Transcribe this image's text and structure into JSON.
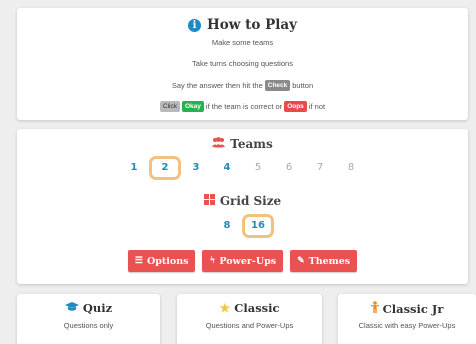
{
  "how_to_play": {
    "title": "How to Play",
    "step1": "Make some teams",
    "step2": "Take turns choosing questions",
    "step3_before": "Say the answer then hit the",
    "step3_pill": "Check",
    "step3_after": "button",
    "step4_click": "Click",
    "step4_okay": "Okay",
    "step4_mid": "if the team is correct or",
    "step4_oops": "Oops",
    "step4_after": "if not"
  },
  "teams": {
    "title": "Teams",
    "options": [
      "1",
      "2",
      "3",
      "4",
      "5",
      "6",
      "7",
      "8"
    ],
    "selected": "2"
  },
  "grid_size": {
    "title": "Grid Size",
    "options": [
      "8",
      "16"
    ],
    "selected": "16"
  },
  "buttons": {
    "options": "Options",
    "power_ups": "Power-Ups",
    "themes": "Themes"
  },
  "modes": [
    {
      "title": "Quiz",
      "desc": "Questions only",
      "icon": "graduation-cap-icon",
      "icon_color": "#1e8bbf"
    },
    {
      "title": "Classic",
      "desc": "Questions and Power-Ups",
      "icon": "star-icon",
      "icon_color": "#f4c542"
    },
    {
      "title": "Classic Jr",
      "desc": "Classic with easy Power-Ups",
      "icon": "child-icon",
      "icon_color": "#f08a24"
    }
  ],
  "colors": {
    "accent_blue": "#1e8bbf",
    "button_red": "#ea5151",
    "selection_border": "#f1c27d",
    "okay_green": "#27b24a",
    "oops_red": "#e84a4a"
  }
}
